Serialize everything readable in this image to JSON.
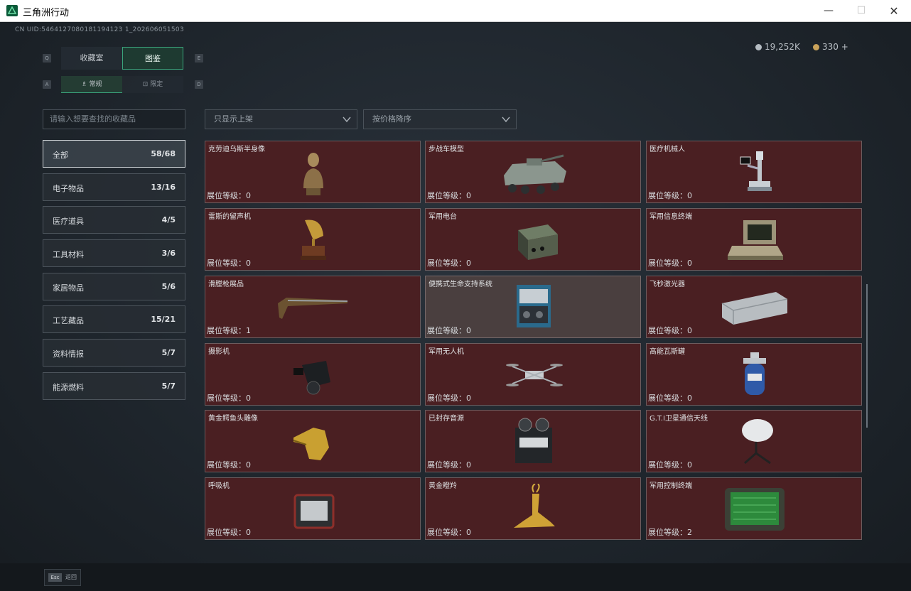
{
  "window": {
    "title": "三角洲行动",
    "minimize": "—",
    "maximize": "☐",
    "close": "✕"
  },
  "uid": "CN UID:5464127080181194123 1_202606051503",
  "currency": [
    {
      "value": "19,252K",
      "icon": "silver-coin-icon",
      "color": "#b5bcc2"
    },
    {
      "value": "330 +",
      "icon": "gold-coin-icon",
      "color": "#c9a25a"
    }
  ],
  "keys": {
    "q": "Q",
    "e": "E",
    "a": "A",
    "d": "D",
    "esc": "Esc"
  },
  "tabs": [
    {
      "label": "收藏室",
      "active": false
    },
    {
      "label": "图鉴",
      "active": true
    }
  ],
  "subtabs": [
    {
      "label": "常规",
      "active": true
    },
    {
      "label": "限定",
      "active": false
    }
  ],
  "search": {
    "placeholder": "请输入想要查找的收藏品"
  },
  "filters": {
    "shelf": "只显示上架",
    "sort": "按价格降序"
  },
  "categories": [
    {
      "name": "全部",
      "count": "58/68",
      "active": true
    },
    {
      "name": "电子物品",
      "count": "13/16"
    },
    {
      "name": "医疗道具",
      "count": "4/5"
    },
    {
      "name": "工具材料",
      "count": "3/6"
    },
    {
      "name": "家居物品",
      "count": "5/6"
    },
    {
      "name": "工艺藏品",
      "count": "15/21"
    },
    {
      "name": "资料情报",
      "count": "5/7"
    },
    {
      "name": "能源燃料",
      "count": "5/7"
    }
  ],
  "items": [
    {
      "name": "克劳迪乌斯半身像",
      "level": "展位等级：0",
      "icon": "bust-icon"
    },
    {
      "name": "步战车模型",
      "level": "展位等级：0",
      "icon": "ifv-model-icon"
    },
    {
      "name": "医疗机械人",
      "level": "展位等级：0",
      "icon": "medical-robot-icon"
    },
    {
      "name": "雷斯的留声机",
      "level": "展位等级：0",
      "icon": "gramophone-icon"
    },
    {
      "name": "军用电台",
      "level": "展位等级：0",
      "icon": "radio-icon"
    },
    {
      "name": "军用信息终端",
      "level": "展位等级：0",
      "icon": "terminal-icon"
    },
    {
      "name": "滑膛枪展品",
      "level": "展位等级：1",
      "icon": "musket-icon"
    },
    {
      "name": "便携式生命支持系统",
      "level": "展位等级：0",
      "icon": "life-support-icon",
      "highlight": true
    },
    {
      "name": "飞秒激光器",
      "level": "展位等级：0",
      "icon": "laser-icon"
    },
    {
      "name": "摄影机",
      "level": "展位等级：0",
      "icon": "camera-icon"
    },
    {
      "name": "军用无人机",
      "level": "展位等级：0",
      "icon": "drone-icon"
    },
    {
      "name": "高能瓦斯罐",
      "level": "展位等级：0",
      "icon": "gas-tank-icon"
    },
    {
      "name": "黄金鳄鱼头雕像",
      "level": "展位等级：0",
      "icon": "croc-statue-icon"
    },
    {
      "name": "已封存音源",
      "level": "展位等级：0",
      "icon": "tape-recorder-icon"
    },
    {
      "name": "G.T.I卫星通信天线",
      "level": "展位等级：0",
      "icon": "satellite-dish-icon"
    },
    {
      "name": "呼吸机",
      "level": "展位等级：0",
      "icon": "ventilator-icon"
    },
    {
      "name": "黄金瞪羚",
      "level": "展位等级：0",
      "icon": "gazelle-icon"
    },
    {
      "name": "军用控制终端",
      "level": "展位等级：2",
      "icon": "control-terminal-icon"
    }
  ],
  "footer": {
    "back": "返回"
  }
}
